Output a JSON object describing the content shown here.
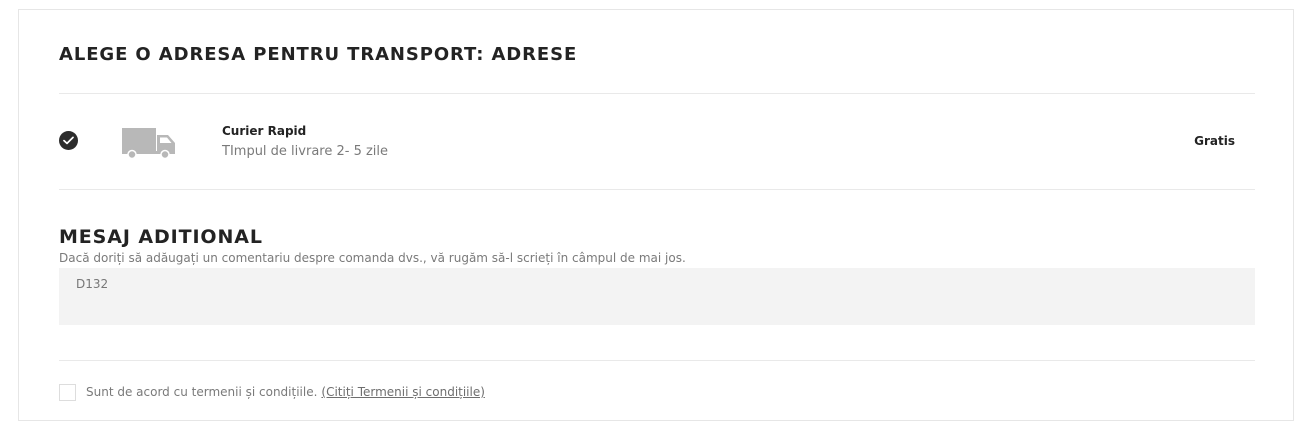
{
  "shipping": {
    "title": "ALEGE O ADRESA PENTRU TRANSPORT: ADRESE",
    "carrier": {
      "name": "Curier Rapid",
      "delay": "TImpul de livrare 2- 5 zile",
      "price": "Gratis",
      "selected": true,
      "icon": "truck-icon"
    }
  },
  "message": {
    "title": "MESAJ ADITIONAL",
    "hint": "Dacă doriți să adăugați un comentariu despre comanda dvs., vă rugăm să-l scrieți în câmpul de mai jos.",
    "value": "D132"
  },
  "terms": {
    "label": "Sunt de acord cu termenii și condițiile.",
    "link_text": "(Citiți Termenii și condițiile)",
    "checked": false
  },
  "colors": {
    "heading": "#232323",
    "muted_text": "#7a7a7a",
    "field_background": "#f3f3f3",
    "divider": "#e9e9e9",
    "check_fill": "#2c2c2c",
    "truck_gray": "#b8b8b8"
  }
}
